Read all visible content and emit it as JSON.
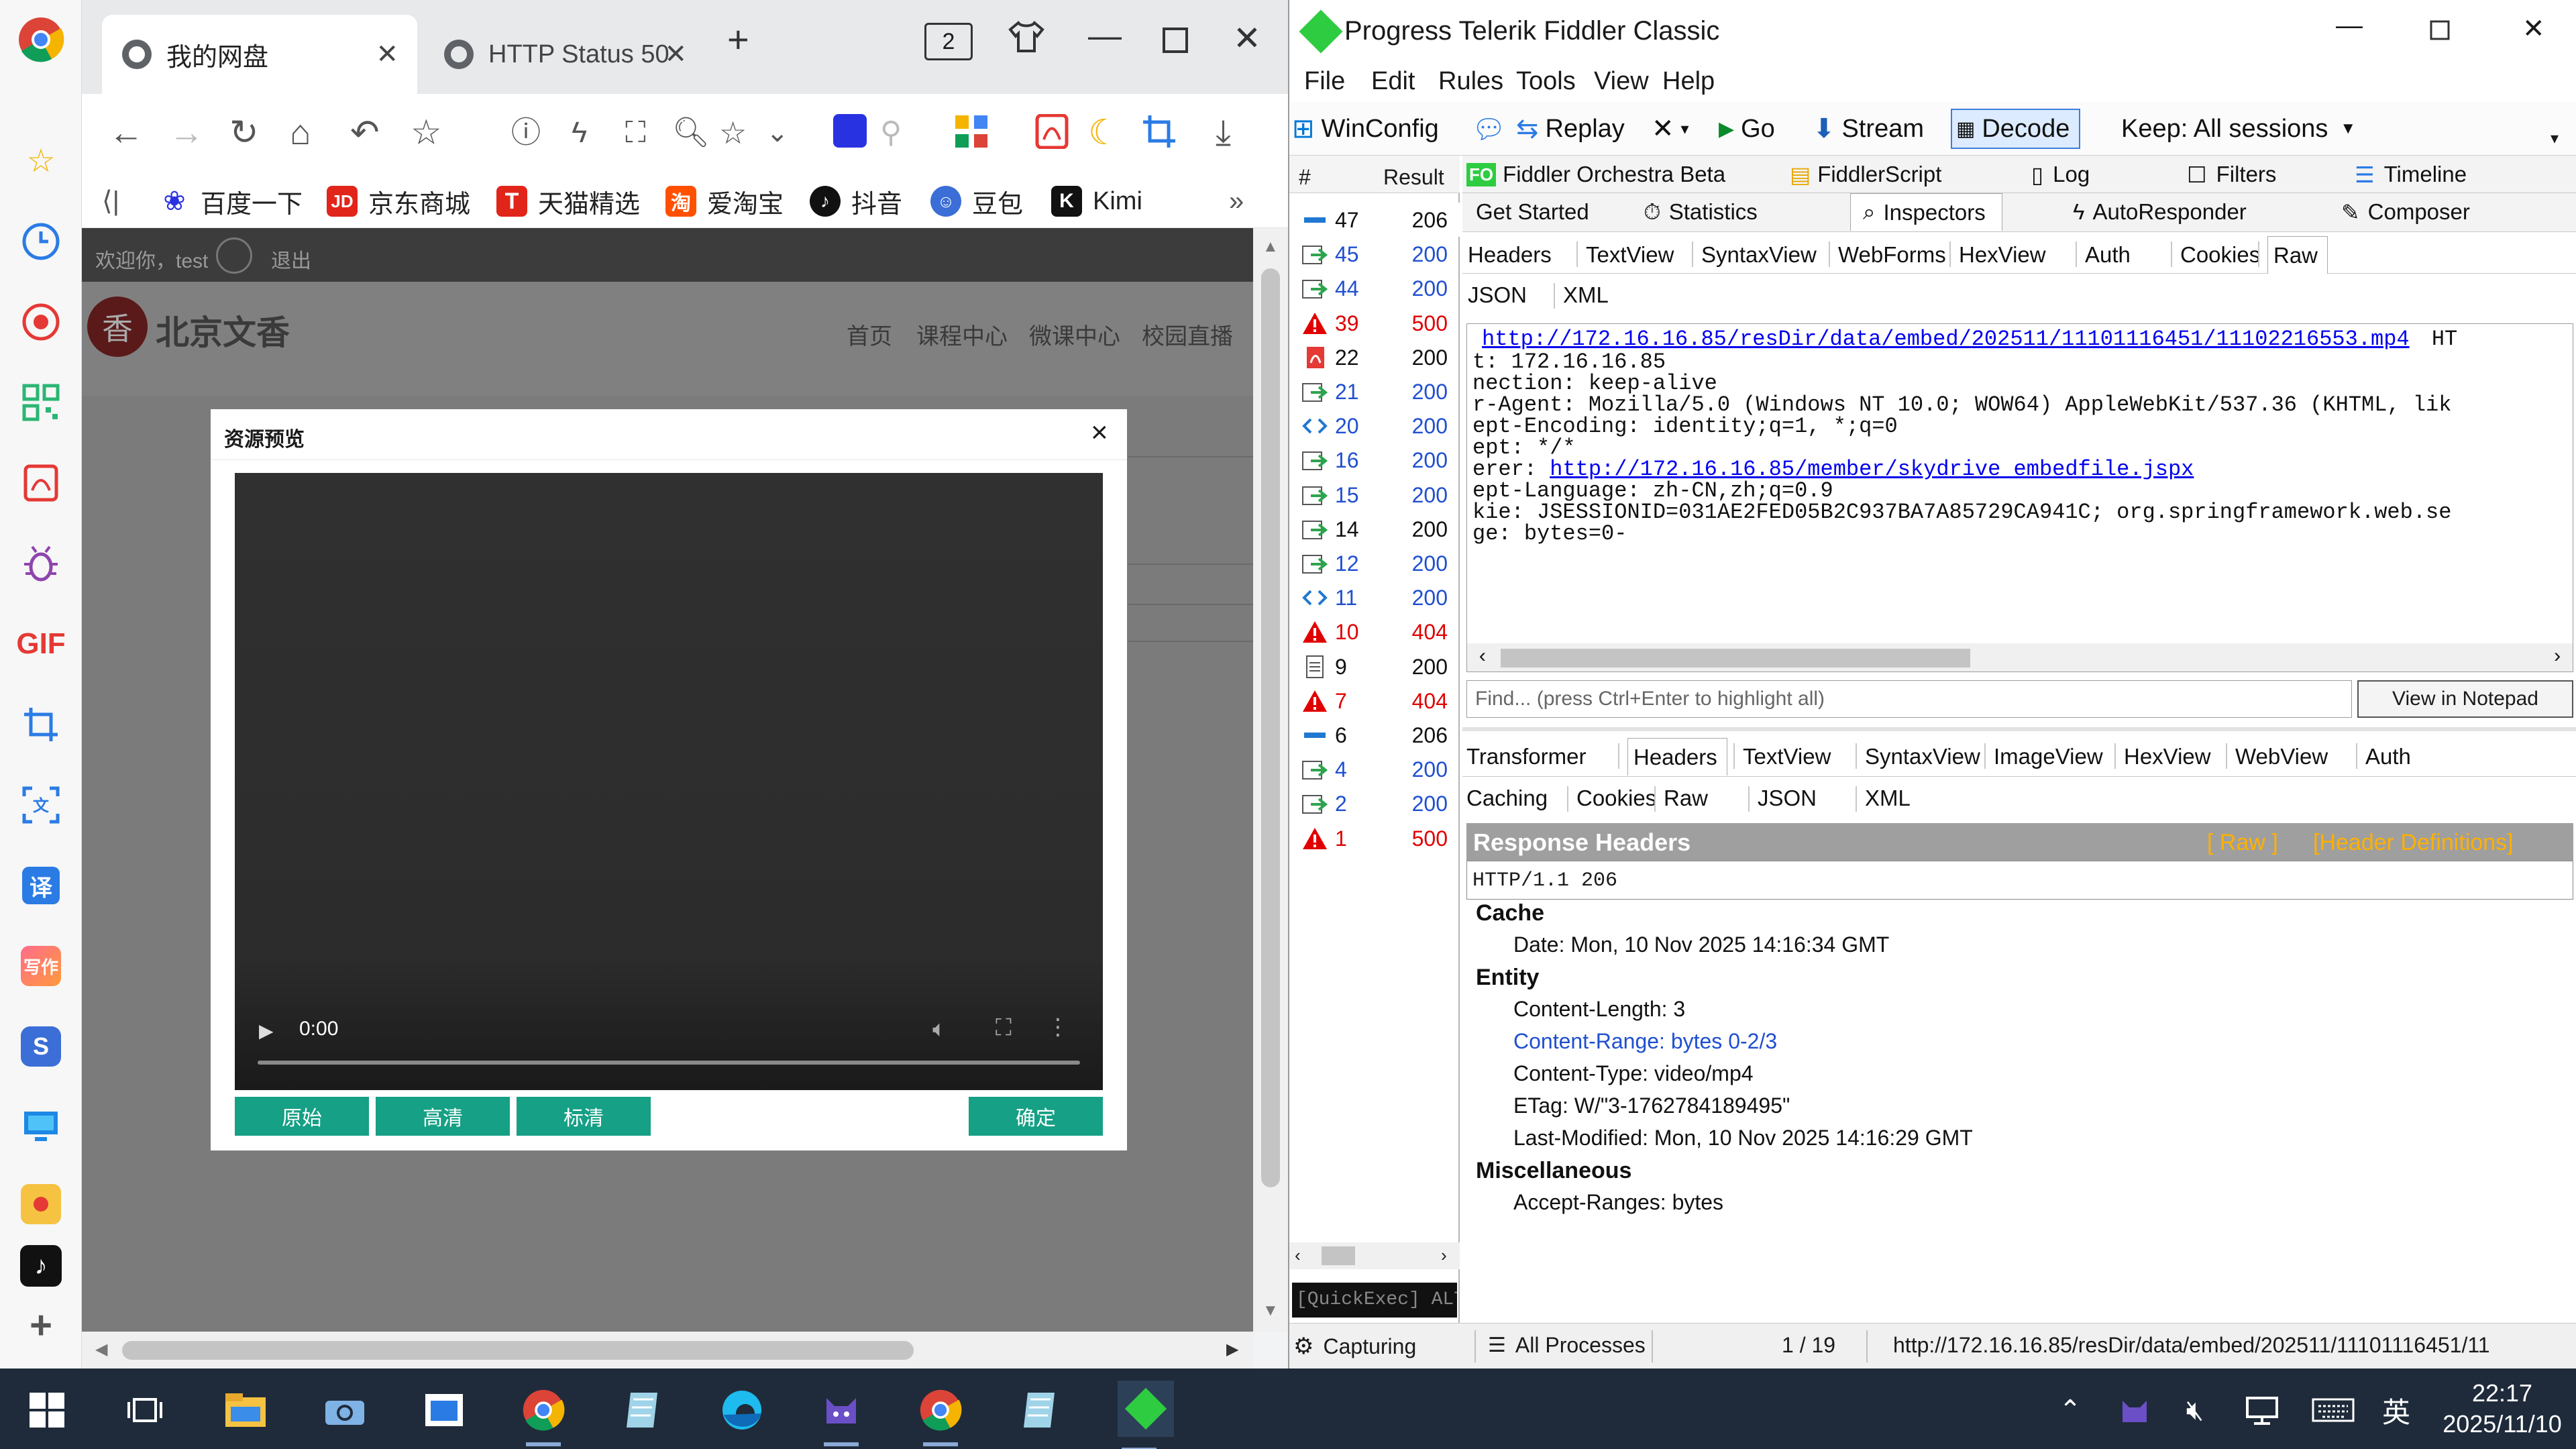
{
  "browser": {
    "tabs": [
      {
        "title": "我的网盘",
        "active": true
      },
      {
        "title": "HTTP Status 50"
      }
    ],
    "tab_count": "2",
    "bookmarks": [
      {
        "label": "百度一下",
        "icon": "baidu-paw-icon",
        "color": "#2932e1"
      },
      {
        "label": "京东商城",
        "icon": "jd-icon",
        "color": "#e1251b"
      },
      {
        "label": "天猫精选",
        "icon": "tmall-icon",
        "color": "#e1251b"
      },
      {
        "label": "爱淘宝",
        "icon": "taobao-icon",
        "color": "#ff5000"
      },
      {
        "label": "抖音",
        "icon": "douyin-icon",
        "color": "#111111"
      },
      {
        "label": "豆包",
        "icon": "doubao-icon",
        "color": "#3b6ed6"
      },
      {
        "label": "Kimi",
        "icon": "kimi-icon",
        "color": "#111111"
      }
    ]
  },
  "page": {
    "welcome": "欢迎你，test",
    "logout": "退出",
    "logo_text": "北京文香",
    "nav": [
      "首页",
      "课程中心",
      "微课中心",
      "校园直播"
    ]
  },
  "modal": {
    "title": "资源预览",
    "close": "×",
    "video_time": "0:00",
    "quality_buttons": [
      "原始",
      "高清",
      "标清"
    ],
    "confirm": "确定"
  },
  "fiddler": {
    "title": "Progress Telerik Fiddler Classic",
    "menu": [
      "File",
      "Edit",
      "Rules",
      "Tools",
      "View",
      "Help"
    ],
    "toolbar": {
      "winconfig": "WinConfig",
      "replay": "Replay",
      "go": "Go",
      "stream": "Stream",
      "decode": "Decode",
      "keep": "Keep: All sessions"
    },
    "list_header": {
      "num": "#",
      "result": "Result"
    },
    "sessions": [
      {
        "id": "47",
        "result": "206",
        "icon": "stream-icon",
        "kind": "normal"
      },
      {
        "id": "45",
        "result": "200",
        "icon": "arrow-icon",
        "kind": "blue"
      },
      {
        "id": "44",
        "result": "200",
        "icon": "arrow-icon",
        "kind": "blue"
      },
      {
        "id": "39",
        "result": "500",
        "icon": "error-icon",
        "kind": "red"
      },
      {
        "id": "22",
        "result": "200",
        "icon": "pdf-icon",
        "kind": "normal"
      },
      {
        "id": "21",
        "result": "200",
        "icon": "arrow-icon",
        "kind": "blue"
      },
      {
        "id": "20",
        "result": "200",
        "icon": "script-icon",
        "kind": "blue"
      },
      {
        "id": "16",
        "result": "200",
        "icon": "arrow-icon",
        "kind": "blue"
      },
      {
        "id": "15",
        "result": "200",
        "icon": "arrow-icon",
        "kind": "blue"
      },
      {
        "id": "14",
        "result": "200",
        "icon": "arrow-icon",
        "kind": "normal"
      },
      {
        "id": "12",
        "result": "200",
        "icon": "arrow-icon",
        "kind": "blue"
      },
      {
        "id": "11",
        "result": "200",
        "icon": "script-icon",
        "kind": "blue"
      },
      {
        "id": "10",
        "result": "404",
        "icon": "error-icon",
        "kind": "red"
      },
      {
        "id": "9",
        "result": "200",
        "icon": "doc-icon",
        "kind": "normal"
      },
      {
        "id": "7",
        "result": "404",
        "icon": "error-icon",
        "kind": "red"
      },
      {
        "id": "6",
        "result": "206",
        "icon": "stream-icon",
        "kind": "normal"
      },
      {
        "id": "4",
        "result": "200",
        "icon": "arrow-icon",
        "kind": "blue"
      },
      {
        "id": "2",
        "result": "200",
        "icon": "arrow-icon",
        "kind": "blue"
      },
      {
        "id": "1",
        "result": "500",
        "icon": "error-icon",
        "kind": "red"
      }
    ],
    "top_tabs_row1": [
      "Fiddler Orchestra Beta",
      "FiddlerScript",
      "Log",
      "Filters",
      "Timeline"
    ],
    "top_tabs_row2": [
      "Get Started",
      "Statistics",
      "Inspectors",
      "AutoResponder",
      "Composer"
    ],
    "req_tabs_row1": [
      "Headers",
      "TextView",
      "SyntaxView",
      "WebForms",
      "HexView",
      "Auth",
      "Cookies",
      "Raw"
    ],
    "req_tabs_row2": [
      "JSON",
      "XML"
    ],
    "raw_request": {
      "url": "http://172.16.16.85/resDir/data/embed/202511/11101116451/11102216553.mp4",
      "url_suffix": "HT",
      "lines": [
        "t: 172.16.16.85",
        "nection: keep-alive",
        "r-Agent: Mozilla/5.0 (Windows NT 10.0; WOW64) AppleWebKit/537.36 (KHTML, lik",
        "ept-Encoding: identity;q=1, *;q=0",
        "ept: */*"
      ],
      "referer_prefix": "erer: ",
      "referer_url": "http://172.16.16.85/member/skydrive_embedfile.jspx",
      "lines2": [
        "ept-Language: zh-CN,zh;q=0.9",
        "kie: JSESSIONID=031AE2FED05B2C937BA7A85729CA941C; org.springframework.web.se",
        "ge: bytes=0-"
      ]
    },
    "find_placeholder": "Find... (press Ctrl+Enter to highlight all)",
    "view_notepad": "View in Notepad",
    "resp_tabs_row1": [
      "Transformer",
      "Headers",
      "TextView",
      "SyntaxView",
      "ImageView",
      "HexView",
      "WebView",
      "Auth"
    ],
    "resp_tabs_row2": [
      "Caching",
      "Cookies",
      "Raw",
      "JSON",
      "XML"
    ],
    "response": {
      "title": "Response Headers",
      "raw_link": "[ Raw ]",
      "defs_link": "[Header Definitions]",
      "status": "HTTP/1.1 206",
      "groups": [
        {
          "name": "Cache",
          "items": [
            "Date: Mon, 10 Nov 2025 14:16:34 GMT"
          ]
        },
        {
          "name": "Entity",
          "items": [
            "Content-Length: 3",
            "Content-Range: bytes 0-2/3",
            "Content-Type: video/mp4",
            "ETag: W/\"3-1762784189495\"",
            "Last-Modified: Mon, 10 Nov 2025 14:16:29 GMT"
          ]
        },
        {
          "name": "Miscellaneous",
          "items": [
            "Accept-Ranges: bytes"
          ]
        }
      ]
    },
    "quickexec": "[QuickExec] ALT",
    "status": {
      "capturing": "Capturing",
      "processes": "All Processes",
      "count": "1 / 19",
      "url": "http://172.16.16.85/resDir/data/embed/202511/11101116451/11"
    }
  },
  "taskbar": {
    "time": "22:17",
    "date": "2025/11/10",
    "ime": "英"
  },
  "colors": {
    "accent_teal": "#16a085",
    "link_blue": "#0000ee",
    "error_red": "#e00000",
    "session_blue": "#1f4fd1",
    "header_orange": "#ffb000"
  }
}
